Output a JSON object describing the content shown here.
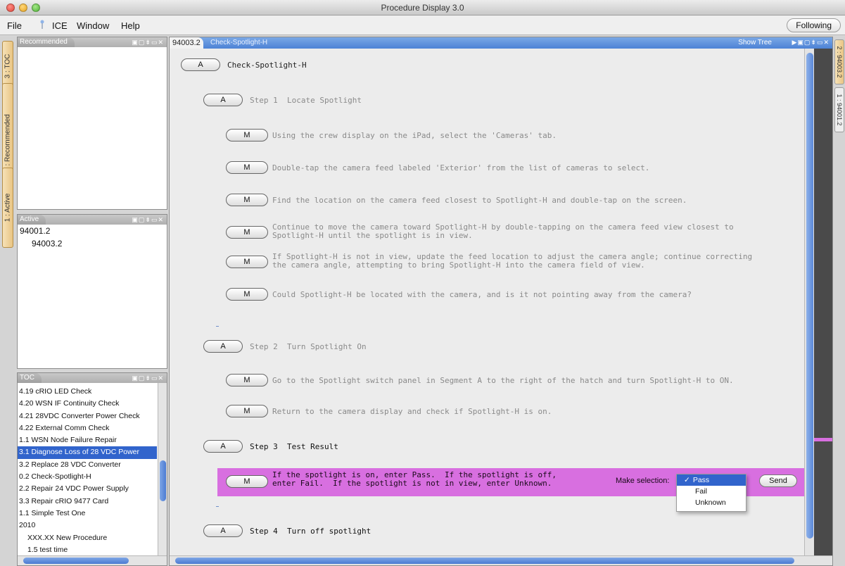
{
  "window": {
    "title": "Procedure Display 3.0"
  },
  "menu": {
    "file": "File",
    "ice": "ICE",
    "window": "Window",
    "help": "Help",
    "following": "Following"
  },
  "left_tabs": [
    "3 : TOC",
    "2 : Recommended",
    "1 : Active"
  ],
  "right_tabs": [
    "2 : 94003.2",
    "1 : 94001.2"
  ],
  "recommended_panel": {
    "title": "Recommended"
  },
  "active_panel": {
    "title": "Active",
    "items": [
      "94001.2",
      "94003.2"
    ]
  },
  "toc_panel": {
    "title": "TOC",
    "items": [
      "4.19 cRIO LED Check",
      "4.20 WSN IF Continuity Check",
      "4.21 28VDC Converter Power Check",
      "4.22 External Comm Check",
      "1.1 WSN Node Failure Repair",
      "3.1 Diagnose Loss of 28 VDC Power",
      "3.2 Replace 28 VDC Converter",
      "0.2 Check-Spotlight-H",
      "2.2 Repair 24 VDC Power Supply",
      "3.3 Repair cRIO 9477 Card",
      "1.1 Simple Test One",
      "2010",
      "XXX.XX New Procedure",
      "1.5 test time"
    ],
    "selected_index": 5
  },
  "main": {
    "tab_id": "94003.2",
    "tab_title": "Check-Spotlight-H",
    "show_tree": "Show Tree",
    "procedure_title": "Check-Spotlight-H",
    "steps": [
      {
        "badge": "A",
        "label": "Step 1  Locate Spotlight"
      },
      {
        "badge": "A",
        "label": "Step 2  Turn Spotlight On"
      },
      {
        "badge": "A",
        "label": "Step 3  Test Result"
      },
      {
        "badge": "A",
        "label": "Step 4  Turn off spotlight"
      }
    ],
    "instructions": [
      "Using the crew display on the iPad, select the 'Cameras' tab.",
      "Double-tap the camera feed labeled 'Exterior' from the list of cameras to select.",
      "Find the location on the camera feed closest to Spotlight-H and double-tap on the screen.",
      "Continue to move the camera toward Spotlight-H by double-tapping on the camera feed view closest to\nSpotlight-H until the spotlight is in view.",
      "If Spotlight-H is not in view, update the feed location to adjust the camera angle; continue correcting\nthe camera angle, attempting to bring Spotlight-H into the camera field of view.",
      "Could Spotlight-H be located with the camera, and is it not pointing away from the camera?",
      "Go to the Spotlight switch panel in Segment A to the right of the hatch and turn Spotlight-H to ON.",
      "Return to the camera display and check if Spotlight-H is on.",
      "If the spotlight is on, enter Pass.  If the spotlight is off,\nenter Fail.  If the spotlight is not in view, enter Unknown."
    ],
    "manual_badge": "M",
    "make_selection_label": "Make selection:",
    "send_label": "Send",
    "dropdown_options": [
      "Pass",
      "Fail",
      "Unknown"
    ],
    "dropdown_selected": "Pass",
    "check_mark": "✓"
  },
  "colors": {
    "highlight": "#d86fe0",
    "selection": "#3164cc",
    "tab_accent": "#e9c583"
  }
}
